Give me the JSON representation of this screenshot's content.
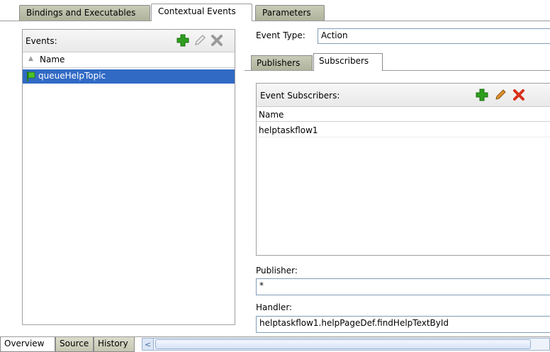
{
  "top_tabs": [
    "Bindings and Executables",
    "Contextual Events",
    "Parameters"
  ],
  "events": {
    "label": "Events:",
    "column_header": "Name",
    "items": [
      "queueHelpTopic"
    ]
  },
  "event_type": {
    "label": "Event Type:",
    "value": "Action"
  },
  "sub_tabs": [
    "Publishers",
    "Subscribers"
  ],
  "subscribers": {
    "label": "Event Subscribers:",
    "column_header": "Name",
    "rows": [
      "helptaskflow1"
    ]
  },
  "publisher": {
    "label": "Publisher:",
    "value": "*"
  },
  "handler": {
    "label": "Handler:",
    "value": "helptaskflow1.helpPageDef.findHelpTextById"
  },
  "bottom_tabs": [
    "Overview",
    "Source",
    "History"
  ],
  "icons": {
    "add": "plus-icon",
    "edit": "pencil-icon",
    "delete": "x-icon",
    "event": "flag-icon",
    "sort": "sort-up-icon",
    "scroll_left": "chevron-left-icon"
  },
  "colors": {
    "selection": "#316ac5",
    "add_green": "#2e9e1e",
    "delete_red": "#d8321c",
    "pencil_orange": "#e0932c"
  }
}
